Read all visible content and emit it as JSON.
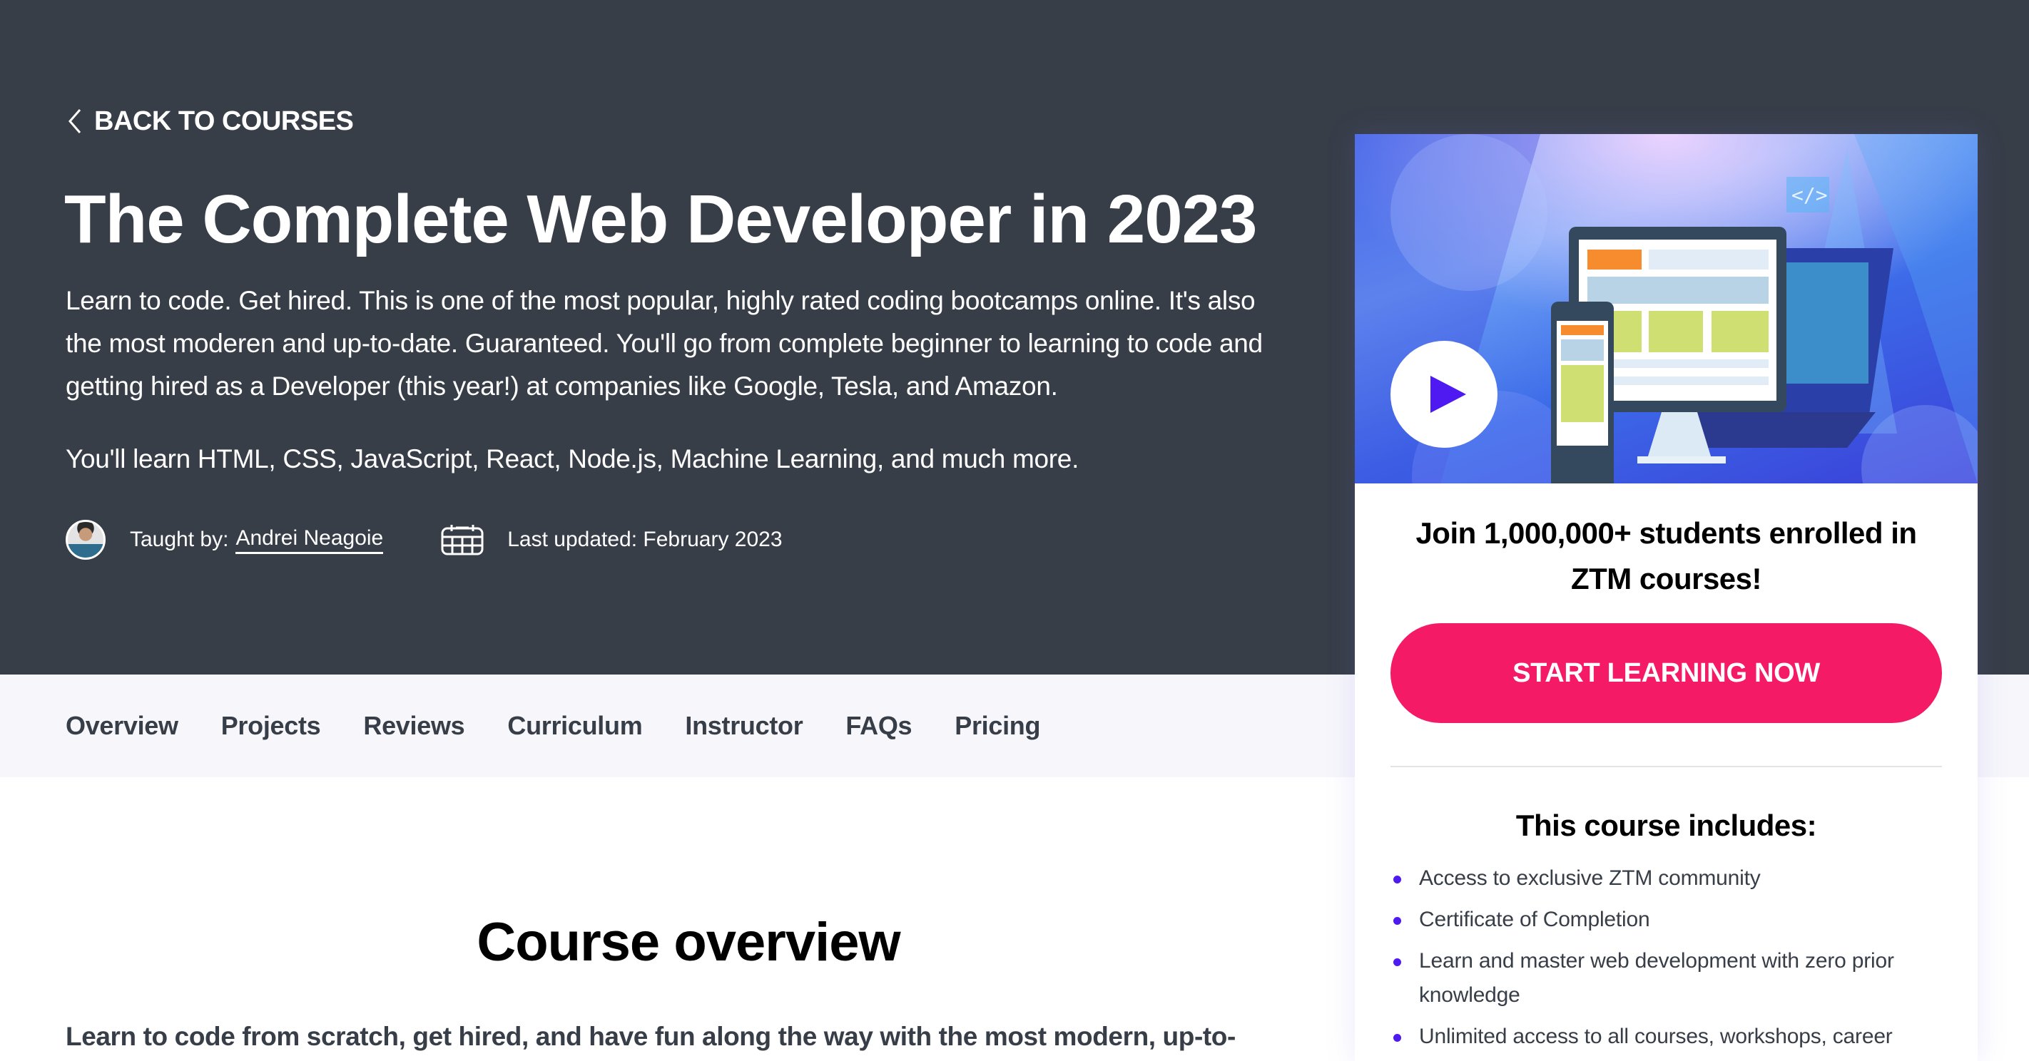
{
  "hero": {
    "back_link": "BACK TO COURSES",
    "title": "The Complete Web Developer in 2023",
    "description": "Learn to code. Get hired. This is one of the most popular, highly rated coding bootcamps online. It's also the most moderen and up-to-date. Guaranteed. You'll go from complete beginner to learning to code and getting hired as a Developer (this year!) at companies like Google, Tesla, and Amazon.",
    "description_2": "You'll learn HTML, CSS, JavaScript, React, Node.js, Machine Learning, and much more.",
    "taught_by_label": "Taught by:",
    "instructor": "Andrei Neagoie",
    "last_updated": "Last updated: February 2023"
  },
  "tabs": [
    {
      "label": "Overview"
    },
    {
      "label": "Projects"
    },
    {
      "label": "Reviews"
    },
    {
      "label": "Curriculum"
    },
    {
      "label": "Instructor"
    },
    {
      "label": "FAQs"
    },
    {
      "label": "Pricing"
    }
  ],
  "overview": {
    "heading": "Course overview",
    "lead": "Learn to code from scratch, get hired, and have fun along the way with the most modern, up-to-"
  },
  "card": {
    "headline": "Join 1,000,000+ students enrolled in ZTM courses!",
    "cta": "START LEARNING NOW",
    "includes_heading": "This course includes:",
    "includes": [
      "Access to exclusive ZTM community",
      "Certificate of Completion",
      "Learn and master web development with zero prior knowledge",
      "Unlimited access to all courses, workshops, career"
    ]
  },
  "colors": {
    "hero_bg": "#373e48",
    "tabbar_bg": "#f6f6fb",
    "cta": "#f51a65",
    "accent": "#4f19f1"
  }
}
